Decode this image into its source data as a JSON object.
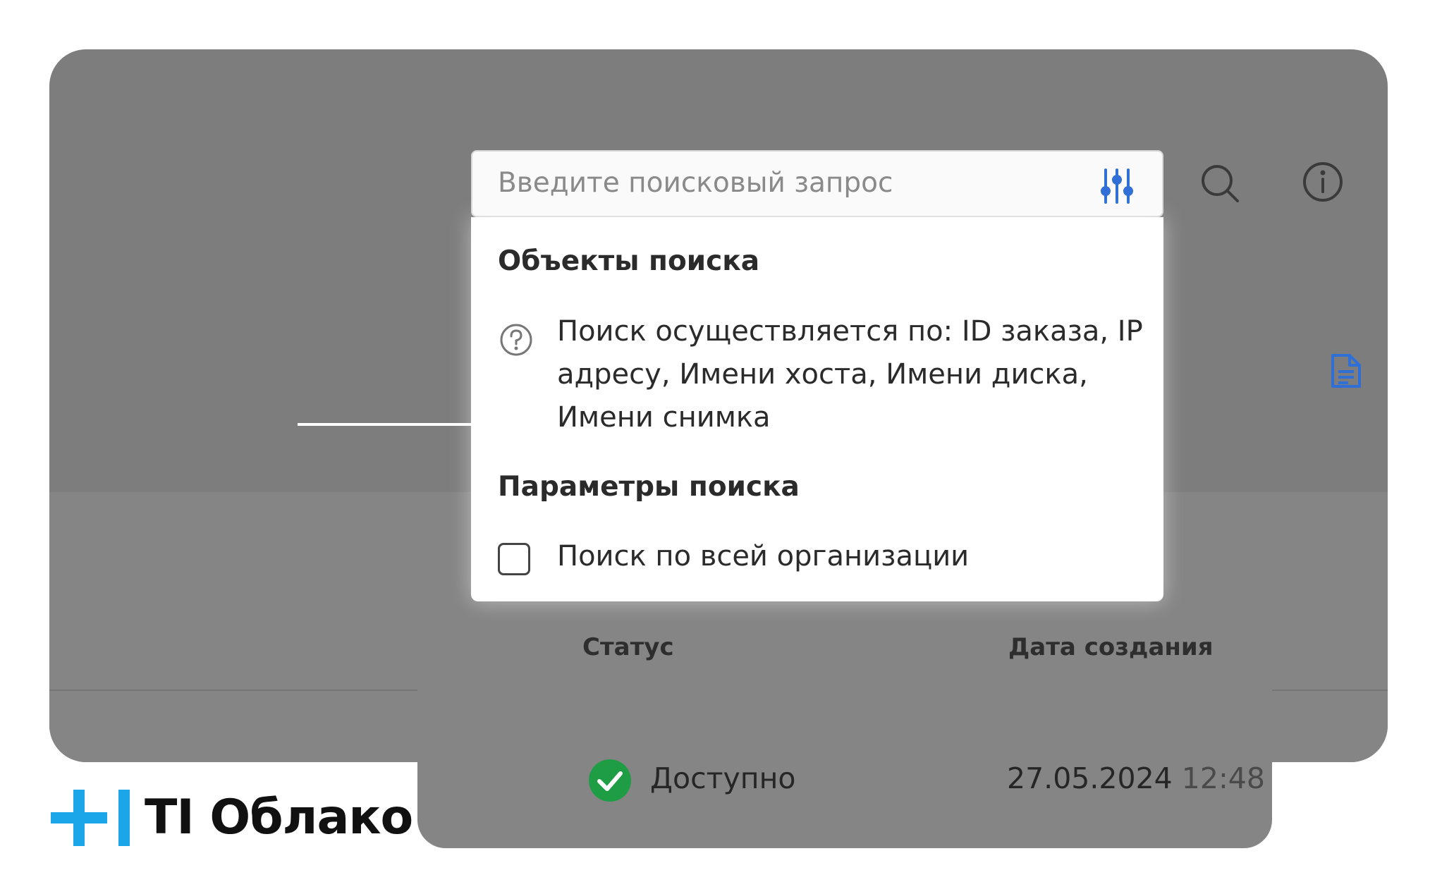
{
  "search": {
    "placeholder": "Введите поисковый запрос"
  },
  "dropdown": {
    "objects_title": "Объекты поиска",
    "objects_help": "Поиск осуществляется по: ID заказа, IP адресу, Имени хоста, Имени диска, Имени снимка",
    "params_title": "Параметры поиска",
    "org_search_label": "Поиск по всей организации",
    "org_search_checked": false
  },
  "table": {
    "headers": {
      "status": "Статус",
      "created": "Дата создания"
    },
    "rows": [
      {
        "status": "Доступно",
        "date": "27.05.2024",
        "time": "12:48"
      }
    ]
  },
  "brand": {
    "name": "TI Облако",
    "accent_color": "#1aa6e8"
  },
  "colors": {
    "overlay": "#7d7d7d",
    "status_ok": "#1f9d45",
    "icon_blue": "#2f6fd6"
  },
  "icons": {
    "filter": "sliders-icon",
    "search": "search-icon",
    "info": "info-icon",
    "document": "document-icon",
    "help": "question-icon",
    "status": "check-circle-icon"
  }
}
